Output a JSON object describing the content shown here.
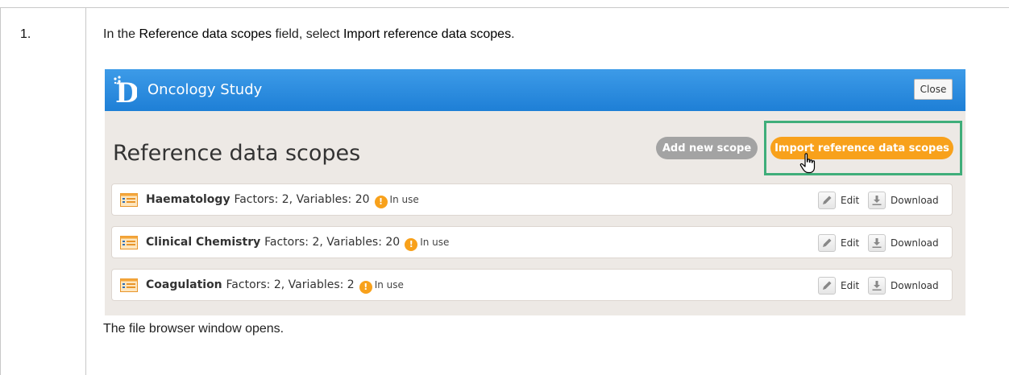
{
  "step": {
    "number": "1.",
    "instruction_parts": [
      "In the ",
      "Reference data scopes",
      " field, select ",
      "Import reference data scopes",
      "."
    ],
    "result": "The file browser window opens."
  },
  "app": {
    "title": "Oncology Study",
    "close_label": "Close",
    "heading": "Reference data scopes",
    "add_new_scope_label": "Add new scope",
    "import_label": "Import reference data scopes",
    "scopes": [
      {
        "name": "Haematology",
        "details": "Factors: 2, Variables: 20",
        "status": "In use",
        "edit": "Edit",
        "download": "Download"
      },
      {
        "name": "Clinical Chemistry",
        "details": "Factors: 2, Variables: 20",
        "status": "In use",
        "edit": "Edit",
        "download": "Download"
      },
      {
        "name": "Coagulation",
        "details": "Factors: 2, Variables: 2",
        "status": "In use",
        "edit": "Edit",
        "download": "Download"
      }
    ]
  },
  "colors": {
    "header_blue": "#1e7fd6",
    "import_orange": "#f8a11b",
    "highlight_green": "#3fae7a"
  }
}
